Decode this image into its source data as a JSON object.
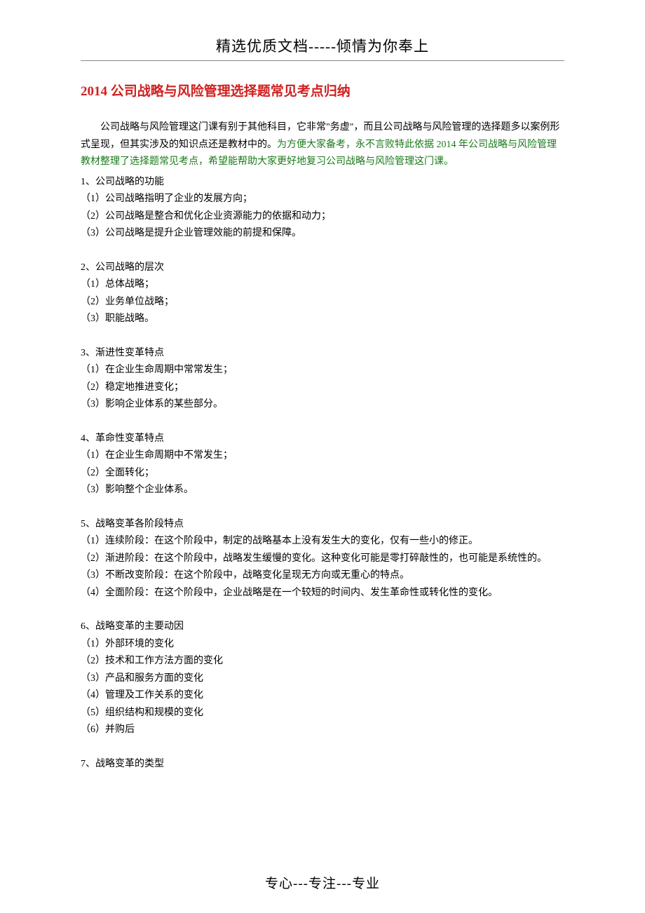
{
  "header": "精选优质文档-----倾情为你奉上",
  "title": "2014 公司战略与风险管理选择题常见考点归纳",
  "intro": {
    "seg1": "公司战略与风险管理这门课有别于其他科目，它非常\"务虚\"，而且公司战略与风险管理的选择题多以案例形式呈现，但其实涉及的知识点还是教材中的。",
    "seg2": "为方便大家备考，永不言败特此依据 2014 年公司战略与风险管理教材整理了选择题常见考点，希望能帮助大家更好地复习公司战略与风险管理这门课。"
  },
  "sections": [
    {
      "title": "1、公司战略的功能",
      "items": [
        "（1）公司战略指明了企业的发展方向；",
        "（2）公司战略是整合和优化企业资源能力的依据和动力；",
        "（3）公司战略是提升企业管理效能的前提和保障。"
      ]
    },
    {
      "title": "2、公司战略的层次",
      "items": [
        "（1）总体战略；",
        "（2）业务单位战略；",
        "（3）职能战略。"
      ]
    },
    {
      "title": "3、渐进性变革特点",
      "items": [
        "（1）在企业生命周期中常常发生；",
        "（2）稳定地推进变化；",
        "（3）影响企业体系的某些部分。"
      ]
    },
    {
      "title": "4、革命性变革特点",
      "items": [
        "（1）在企业生命周期中不常发生；",
        "（2）全面转化；",
        "（3）影响整个企业体系。"
      ]
    },
    {
      "title": "5、战略变革各阶段特点",
      "items": [
        "（1）连续阶段：在这个阶段中，制定的战略基本上没有发生大的变化，仅有一些小的修正。",
        "（2）渐进阶段：在这个阶段中，战略发生缓慢的变化。这种变化可能是零打碎敲性的，也可能是系统性的。",
        "（3）不断改变阶段：在这个阶段中，战略变化呈现无方向或无重心的特点。",
        "（4）全面阶段：在这个阶段中，企业战略是在一个较短的时间内、发生革命性或转化性的变化。"
      ]
    },
    {
      "title": "6、战略变革的主要动因",
      "items": [
        "（1）外部环境的变化",
        "（2）技术和工作方法方面的变化",
        "（3）产品和服务方面的变化",
        "（4）管理及工作关系的变化",
        "（5）组织结构和规模的变化",
        "（6）并购后"
      ]
    },
    {
      "title": "7、战略变革的类型",
      "items": []
    }
  ],
  "footer": "专心---专注---专业"
}
